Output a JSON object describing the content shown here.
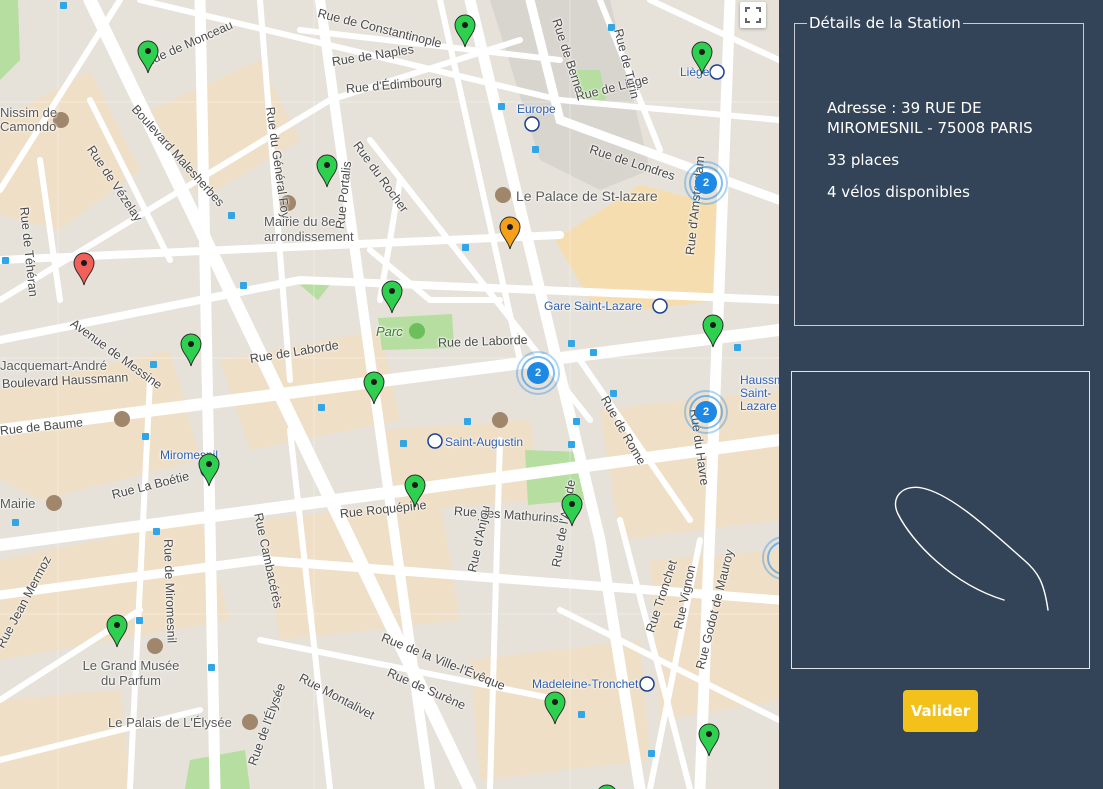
{
  "map": {
    "fullscreen_icon": "fullscreen-icon",
    "street_labels": [
      "Rue de Monceau",
      "Rue de Naples",
      "Rue d'Édimbourg",
      "Rue de Constantinople",
      "Boulevard Malesherbes",
      "Rue du Rocher",
      "Rue du Général Foy",
      "Rue Portalis",
      "Rue de Vézelay",
      "Rue de Téhéran",
      "Avenue de Messine",
      "Rue de Laborde",
      "Boulevard Haussmann",
      "Rue La Boétie",
      "Rue de Miromesnil",
      "Rue Cambacérès",
      "Rue Roquépine",
      "Rue des Mathurins",
      "Rue d'Anjou",
      "Rue de l'Arcade",
      "Rue Tronchet",
      "Rue Vignon",
      "Rue Godot de Mauroy",
      "Rue de la Ville-l'Évêque",
      "Rue de Surène",
      "Rue Montalivet",
      "Rue Jean Mermoz",
      "Rue de Rome",
      "Rue du Havre",
      "Rue d'Amsterdam",
      "Rue de Londres",
      "Rue de Liège",
      "Rue de Turin",
      "Rue de Berne",
      "Rue de Baume",
      "Rue de l'Élysée"
    ],
    "poi_labels": [
      "Nissim de Camondo",
      "Mairie du 8e arrondissement",
      "Le Palace de St-lazare",
      "Parc",
      "Jacquemart-André",
      "Le Grand Musée du Parfum",
      "Le Palais de L'Élysée",
      "Mairie"
    ],
    "transit_labels": [
      "Europe",
      "Liège",
      "Gare Saint-Lazare",
      "Saint-Augustin",
      "Miromesnil",
      "Madeleine-Tronchet",
      "Haussmann Saint-Lazare"
    ],
    "clusters": [
      {
        "count": "2"
      },
      {
        "count": "2"
      },
      {
        "count": "2"
      }
    ],
    "marker_colors": {
      "available": "#2ed14f",
      "selected": "#f5a01a",
      "empty": "#f2605a"
    }
  },
  "panel": {
    "legend": "Détails de la Station",
    "address": "Adresse : 39 RUE DE MIROMESNIL - 75008 PARIS",
    "places": "33 places",
    "bikes": "4 vélos disponibles",
    "validate_label": "Valider"
  }
}
